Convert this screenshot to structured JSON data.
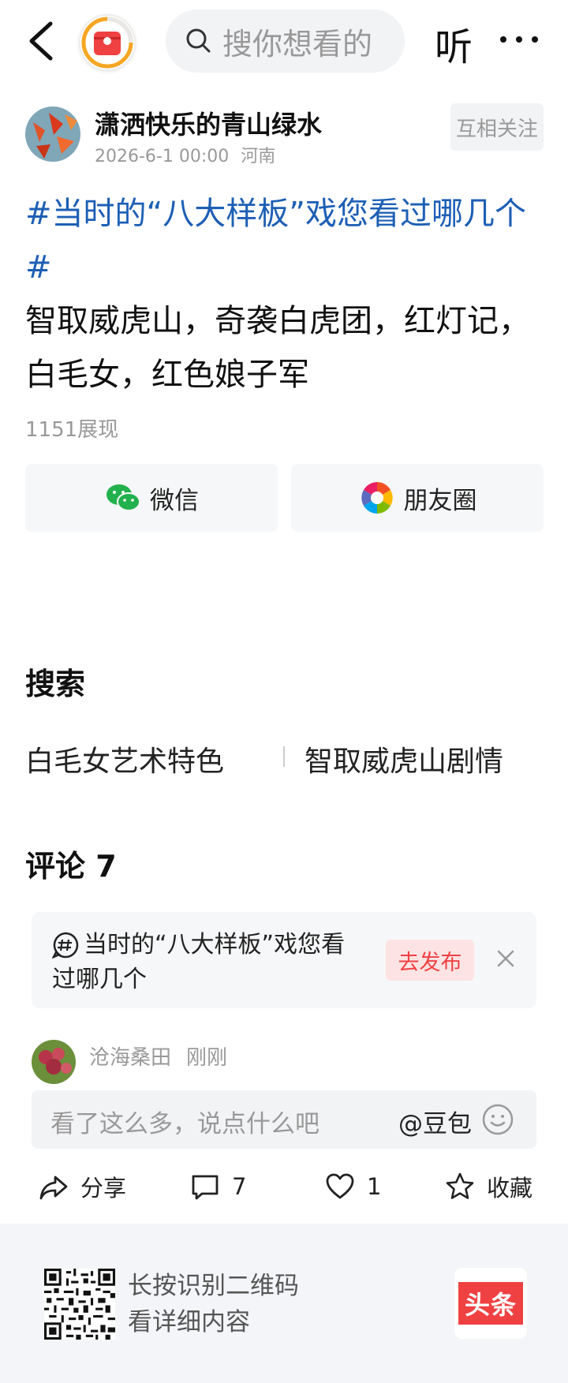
{
  "header": {
    "search_placeholder": "搜你想看的",
    "listen_label": "听"
  },
  "author": {
    "name": "潇洒快乐的青山绿水",
    "datetime": "2026-6-1 00:00",
    "location": "河南",
    "follow_label": "互相关注"
  },
  "post": {
    "hashtag_line1": "#当时的“八大样板”戏您看过哪几个",
    "hashtag_line2": "#",
    "body": "智取威虎山，奇袭白虎团，红灯记，白毛女，红色娘子军",
    "views": "1151展现"
  },
  "share": {
    "wechat_label": "微信",
    "moments_label": "朋友圈"
  },
  "search_section": {
    "title": "搜索",
    "links": [
      "白毛女艺术特色",
      "智取威虎山剧情"
    ]
  },
  "comments": {
    "title": "评论 7",
    "topic_text": "当时的“八大样板”戏您看过哪几个",
    "publish_label": "去发布",
    "first_user": "沧海桑田",
    "first_time": "刚刚"
  },
  "input": {
    "placeholder": "看了这么多，说点什么吧",
    "doubao_label": "@豆包"
  },
  "actions": {
    "share_label": "分享",
    "comment_count": "7",
    "like_count": "1",
    "collect_label": "收藏"
  },
  "footer": {
    "line1": "长按识别二维码",
    "line2": "看详细内容",
    "brand": "头条"
  },
  "colors": {
    "hashtag": "#1d5fb5",
    "brand_red": "#f04142",
    "wechat_green": "#22b14c"
  }
}
